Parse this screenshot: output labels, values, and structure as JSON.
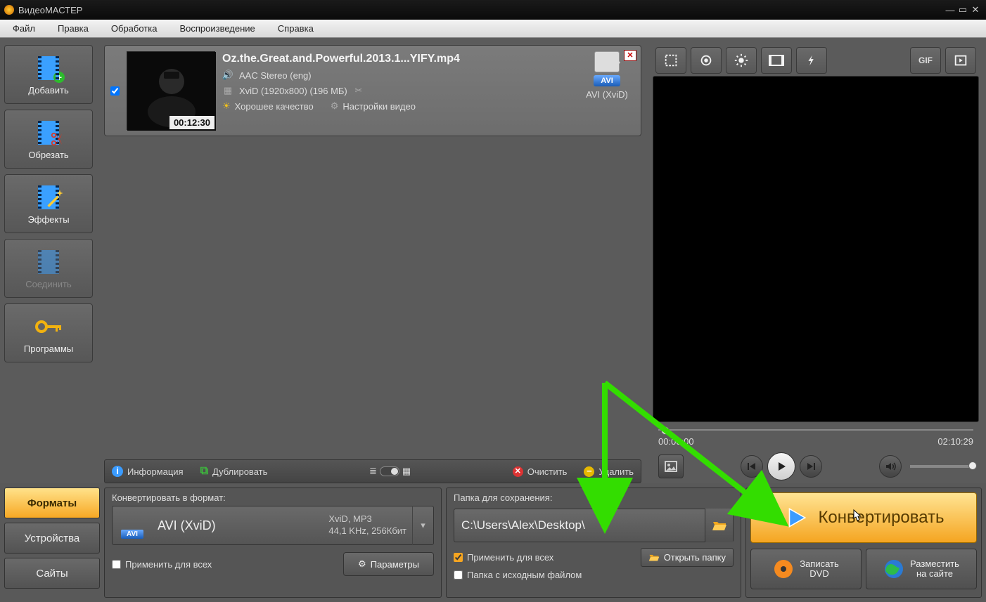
{
  "app": {
    "title": "ВидеоМАСТЕР"
  },
  "menu": {
    "file": "Файл",
    "edit": "Правка",
    "processing": "Обработка",
    "playback": "Воспроизведение",
    "help": "Справка"
  },
  "sidebar": {
    "add": "Добавить",
    "trim": "Обрезать",
    "effects": "Эффекты",
    "join": "Соединить",
    "programs": "Программы"
  },
  "file": {
    "name": "Oz.the.Great.and.Powerful.2013.1...YIFY.mp4",
    "duration": "00:12:30",
    "audio": "AAC Stereo (eng)",
    "video": "XviD (1920x800) (196 МБ)",
    "quality": "Хорошее качество",
    "settings_link": "Настройки видео",
    "target_badge": "AVI",
    "target_label": "AVI (XviD)"
  },
  "listbar": {
    "info": "Информация",
    "duplicate": "Дублировать",
    "clear": "Очистить",
    "delete": "Удалить"
  },
  "preview": {
    "time_current": "00:00:00",
    "time_total": "02:10:29"
  },
  "tabs": {
    "formats": "Форматы",
    "devices": "Устройства",
    "sites": "Сайты"
  },
  "format_panel": {
    "header": "Конвертировать в формат:",
    "badge": "AVI",
    "name": "AVI (XviD)",
    "line1": "XviD, MP3",
    "line2": "44,1 KHz, 256Кбит",
    "apply_all": "Применить для всех",
    "params": "Параметры"
  },
  "save_panel": {
    "header": "Папка для сохранения:",
    "path": "C:\\Users\\Alex\\Desktop\\",
    "apply_all": "Применить для всех",
    "use_source": "Папка с исходным файлом",
    "open": "Открыть папку"
  },
  "actions": {
    "convert": "Конвертировать",
    "burn_line1": "Записать",
    "burn_line2": "DVD",
    "publish_line1": "Разместить",
    "publish_line2": "на сайте"
  }
}
